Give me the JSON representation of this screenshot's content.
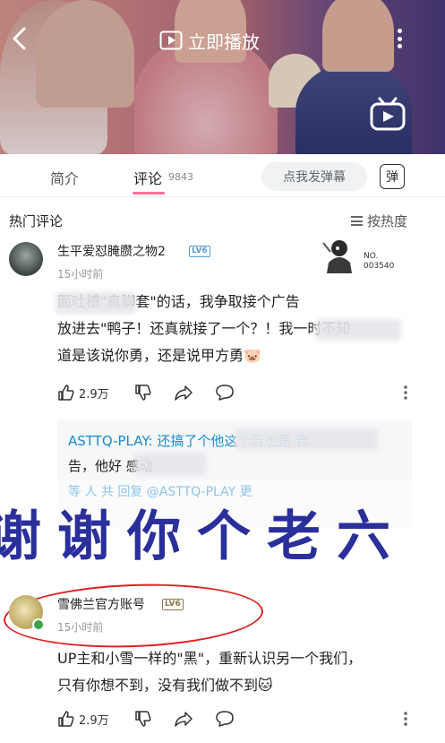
{
  "video": {
    "play_now_label": "立即播放",
    "icons": [
      "back-icon",
      "play-icon",
      "more-icon",
      "bilibili-tv-icon"
    ]
  },
  "tabs": {
    "intro_label": "简介",
    "comments_label": "评论",
    "comments_count": "9843",
    "danmaku_placeholder": "点我发弹幕",
    "danmaku_button_label": "弹"
  },
  "comments_section": {
    "hot_label": "热门评论",
    "sort_label": "按热度"
  },
  "comments": [
    {
      "username": "生平爱怼腌臜之物2",
      "level": "LV6",
      "time": "15小时前",
      "fan_badge_label": "NO.",
      "fan_badge_number": "003540",
      "text_lines": [
        "面吐槽\"真脚套\"的话，我争取接个广告",
        "放进去\"鸭子！还真就接了一个？！我一时不知",
        "道是该说你勇，还是说甲方勇🐷"
      ],
      "likes": "2.9万",
      "reply": {
        "author": "ASTTQ-PLAY",
        "text_line1": "ASTTQ-PLAY: 还搞了个他这个告也是 告",
        "text_line2": "告，他好    感动",
        "more": "等   人 共 回复 @ASTTQ-PLAY 更"
      }
    },
    {
      "username": "雪佛兰官方账号",
      "level": "LV6",
      "time": "15小时前",
      "text_lines": [
        "UP主和小雪一样的\"黑\"，重新认识另一个我们，",
        "只有你想不到，没有我们做不到🐱"
      ],
      "likes": "2.9万"
    }
  ],
  "overlay": {
    "text": "谢谢你个老六"
  },
  "colors": {
    "accent_pink": "#fb7299",
    "link_blue": "#178bcf",
    "overlay_text": "#2a2f9c",
    "circle_mark": "#e02020"
  }
}
